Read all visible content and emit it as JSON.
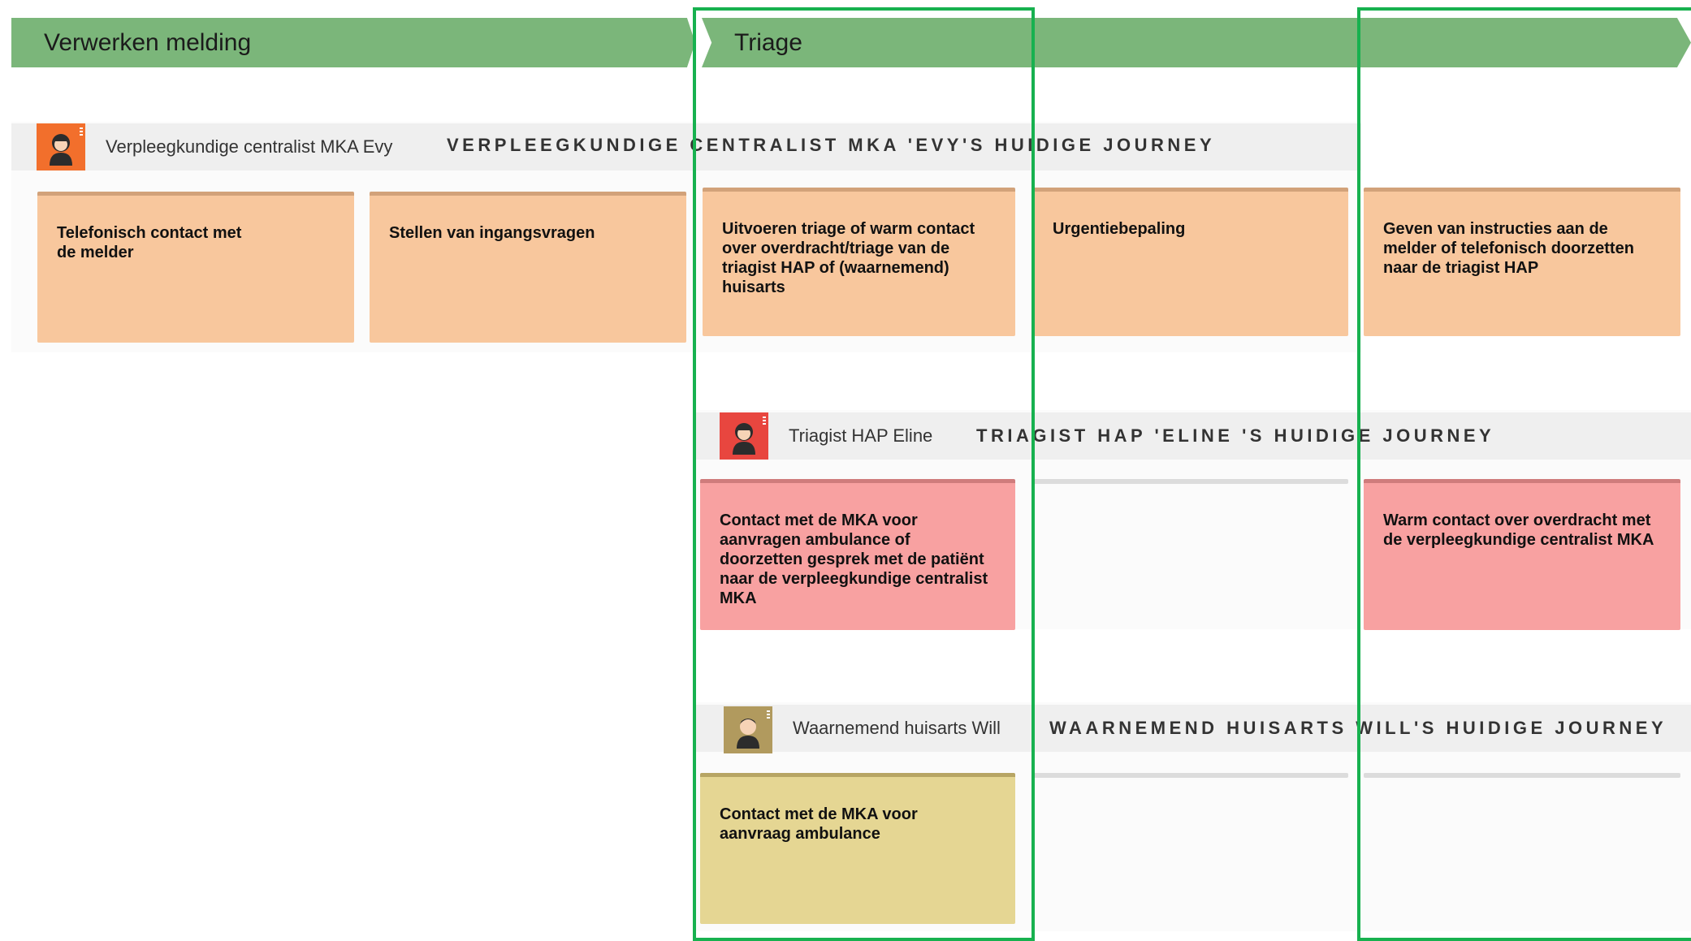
{
  "phases": [
    "Verwerken melding",
    "Triage"
  ],
  "lanes": [
    {
      "persona": "Verpleegkundige centralist MKA Evy",
      "journey": "VERPLEEGKUNDIGE CENTRALIST MKA 'EVY'S HUIDIGE JOURNEY",
      "avatar_color": "#f26f2c",
      "cards": [
        "Telefonisch contact met de melder",
        "Stellen van ingangsvragen",
        "Uitvoeren triage of warm contact over overdracht/triage van de triagist HAP of (waarnemend) huisarts",
        "Urgentiebepaling",
        "Geven van instructies aan de melder of telefonisch doorzetten naar de triagist HAP"
      ]
    },
    {
      "persona": "Triagist HAP Eline",
      "journey": "TRIAGIST HAP 'ELINE 'S HUIDIGE JOURNEY",
      "avatar_color": "#e8463f",
      "cards": [
        "Contact met de MKA voor aanvragen ambulance of doorzetten gesprek met de patiënt naar de verpleegkundige centralist MKA",
        "Warm contact over overdracht met de verpleegkundige centralist MKA"
      ]
    },
    {
      "persona": "Waarnemend huisarts Will",
      "journey": "WAARNEMEND HUISARTS WILL'S HUIDIGE JOURNEY",
      "avatar_color": "#b19a5e",
      "cards": [
        "Contact met de MKA voor aanvraag ambulance"
      ]
    }
  ],
  "colors": {
    "phase_bar": "#7bb67a",
    "highlight_frame": "#17b14f",
    "card_orange": "#f8c79d",
    "card_red": "#f8a1a1",
    "card_yellow": "#e5d693"
  }
}
